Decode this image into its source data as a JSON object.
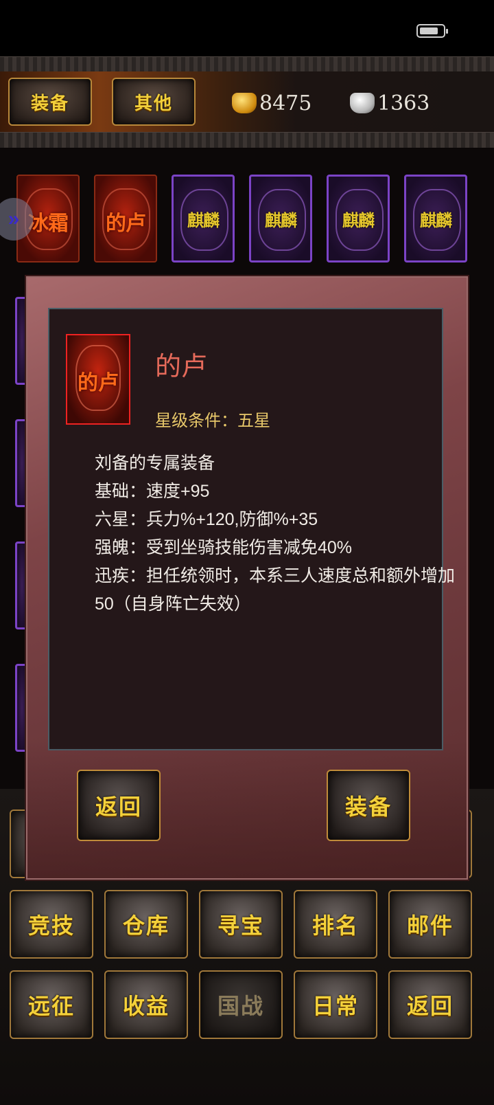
{
  "top_tabs": [
    "装备",
    "其他"
  ],
  "currency": {
    "gold": "8475",
    "silver": "1363"
  },
  "slots": [
    {
      "label": "冰霜",
      "kind": "red"
    },
    {
      "label": "的卢",
      "kind": "red"
    },
    {
      "label": "麒麟",
      "kind": "purple"
    },
    {
      "label": "麒麟",
      "kind": "purple"
    },
    {
      "label": "麒麟",
      "kind": "purple"
    },
    {
      "label": "麒麟",
      "kind": "purple"
    }
  ],
  "dialog": {
    "icon_label": "的卢",
    "name": "的卢",
    "star_condition": "星级条件：五星",
    "description": [
      "刘备的专属装备",
      "基础：速度+95",
      "六星：兵力%+120,防御%+35",
      "强魄：受到坐骑技能伤害减免40%",
      "迅疾：担任统领时，本系三人速度总和额外增加",
      "50（自身阵亡失效）"
    ],
    "back_button": "返回",
    "equip_button": "装备"
  },
  "bottom_menu": {
    "row1": [
      "竞技",
      "仓库",
      "寻宝",
      "排名",
      "邮件"
    ],
    "row2": [
      "远征",
      "收益",
      "国战",
      "日常",
      "返回"
    ],
    "disabled": "国战"
  },
  "colors": {
    "gold_text": "#f4d13a",
    "item_name": "#e56a5a",
    "purple_frame": "#7b43c6",
    "red_frame": "#8a2a14"
  },
  "icons": {
    "gold": "gold-ingot-icon",
    "silver": "silver-ingot-icon",
    "battery": "battery-icon",
    "side": "double-chevron-right-icon"
  }
}
